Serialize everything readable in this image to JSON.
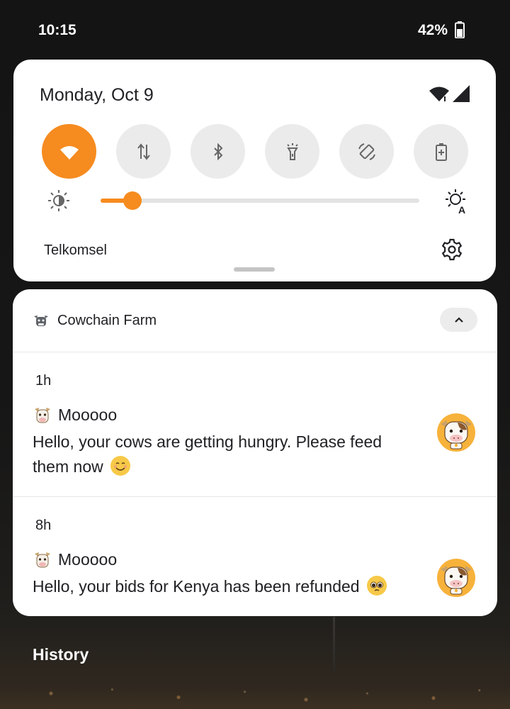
{
  "status_bar": {
    "time": "10:15",
    "battery_percent": "42%",
    "icons": [
      "battery-icon"
    ]
  },
  "quick_settings": {
    "date": "Monday, Oct 9",
    "status_icons": [
      "wifi-icon",
      "cellular-signal-icon"
    ],
    "tiles": [
      {
        "name": "wifi",
        "icon": "wifi-icon",
        "active": true
      },
      {
        "name": "mobile-data",
        "icon": "data-arrows-icon",
        "active": false
      },
      {
        "name": "bluetooth",
        "icon": "bluetooth-icon",
        "active": false
      },
      {
        "name": "flashlight",
        "icon": "flashlight-icon",
        "active": false
      },
      {
        "name": "auto-rotate",
        "icon": "rotate-icon",
        "active": false
      },
      {
        "name": "battery-saver",
        "icon": "battery-saver-icon",
        "active": false
      }
    ],
    "brightness_level": 0.1,
    "carrier": "Telkomsel",
    "accent_color": "#f68b1f"
  },
  "notification_group": {
    "app_name": "Cowchain Farm",
    "notifications": [
      {
        "time": "1h",
        "title": "Mooooo",
        "body": "Hello, your cows are getting hungry. Please feed them now",
        "emoji": "smiling-face-emoji"
      },
      {
        "time": "8h",
        "title": "Mooooo",
        "body": "Hello, your bids for Kenya has been refunded",
        "emoji": "pleading-face-emoji"
      }
    ]
  },
  "footer": {
    "history_label": "History"
  }
}
